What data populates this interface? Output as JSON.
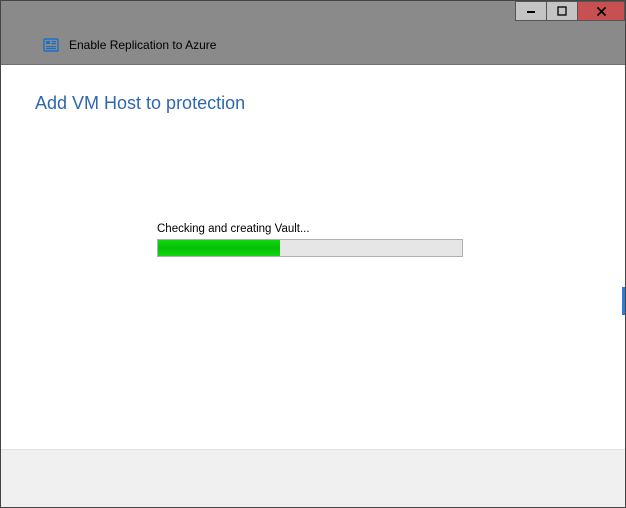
{
  "window": {
    "title": "Enable Replication to Azure"
  },
  "page": {
    "heading": "Add VM Host to protection"
  },
  "progress": {
    "label": "Checking and creating Vault...",
    "percent": 40
  },
  "colors": {
    "title_bar": "#8a8a8a",
    "heading": "#2e66b1",
    "progress_fill": "#0fd80f",
    "close_button": "#c75050"
  }
}
